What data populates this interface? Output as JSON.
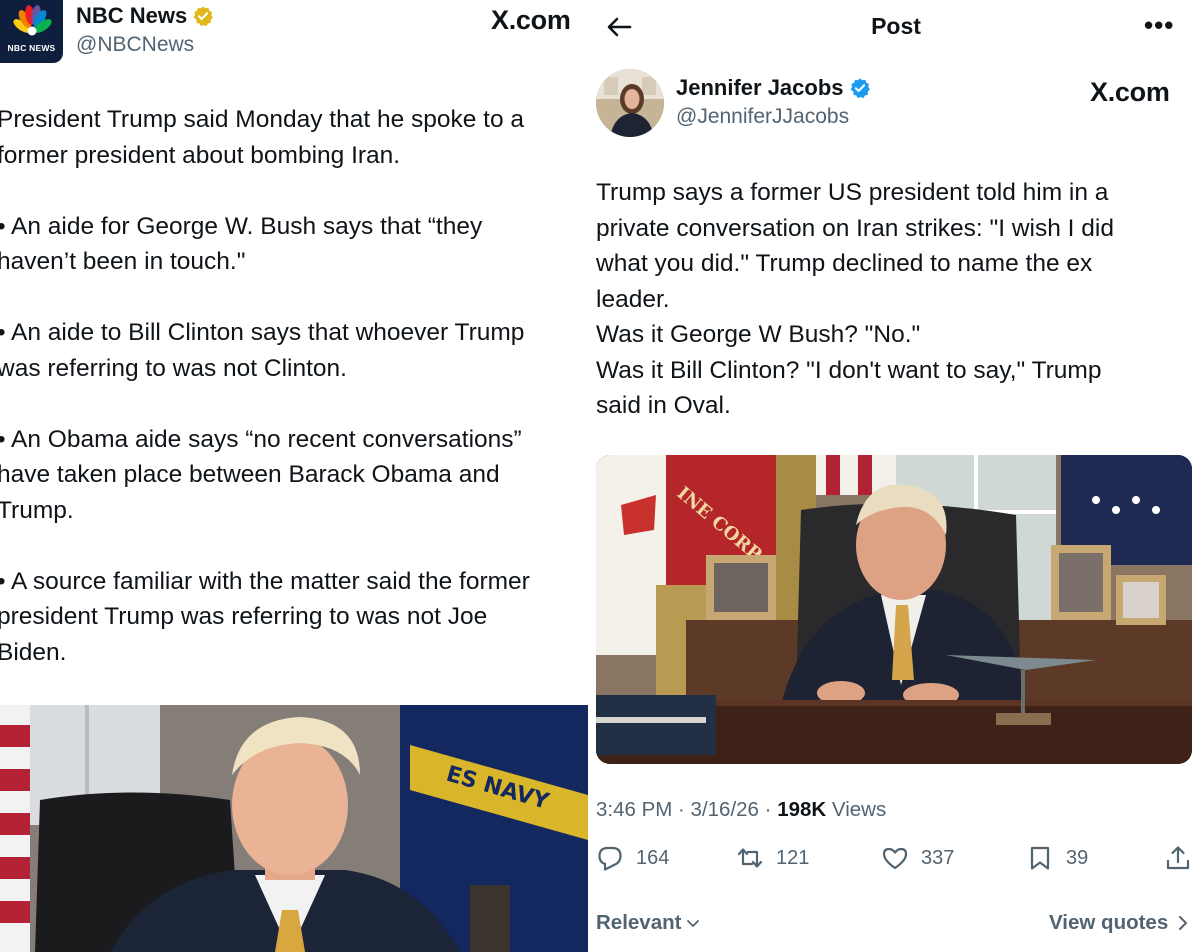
{
  "left_post": {
    "account_name": "NBC News",
    "handle": "@NBCNews",
    "logo_text": "NBC NEWS",
    "watermark": "X.com",
    "paragraphs": [
      "President Trump said Monday that he spoke to a\nformer president about bombing Iran.",
      "• An aide for George W. Bush says that “they\nhaven’t been in touch.\"",
      "• An aide to Bill Clinton says that whoever Trump\nwas referring to was not Clinton.",
      "• An Obama aide says “no recent conversations”\nhave taken place between Barack Obama and\nTrump.",
      "• A source familiar with the matter said the former\npresident Trump was referring to was not Joe\nBiden."
    ],
    "photo_text": "ES NAVY"
  },
  "right_post": {
    "header_title": "Post",
    "more_label": "•••",
    "account_name": "Jennifer Jacobs",
    "handle": "@JenniferJJacobs",
    "watermark": "X.com",
    "text_lines": [
      "Trump says a former US president told him in a",
      "private conversation on Iran strikes: \"I wish I did",
      "what you did.\" Trump declined to name the ex",
      "leader.",
      "Was it George W Bush? \"No.\"",
      "Was it Bill Clinton? \"I don't want to say,\" Trump",
      "said in Oval."
    ],
    "photo_text": "INE CORP",
    "time": "3:46 PM · 3/16/26 · ",
    "views_count": "198K",
    "views_label": " Views",
    "replies": "164",
    "reposts": "121",
    "likes": "337",
    "bookmarks": "39",
    "sort_label": "Relevant",
    "view_quotes_label": "View quotes"
  },
  "colors": {
    "text": "#0f1419",
    "secondary": "#536471",
    "verified_blue": "#1d9bf0",
    "verified_gold": "#e2b719",
    "nbc_navy": "#0d1f3c"
  },
  "icons": [
    "nbc-peacock-icon",
    "verified-gold-icon",
    "back-arrow-icon",
    "more-icon",
    "verified-blue-icon",
    "reply-icon",
    "repost-icon",
    "like-icon",
    "bookmark-icon",
    "share-icon",
    "chevron-down-icon",
    "chevron-right-icon"
  ]
}
